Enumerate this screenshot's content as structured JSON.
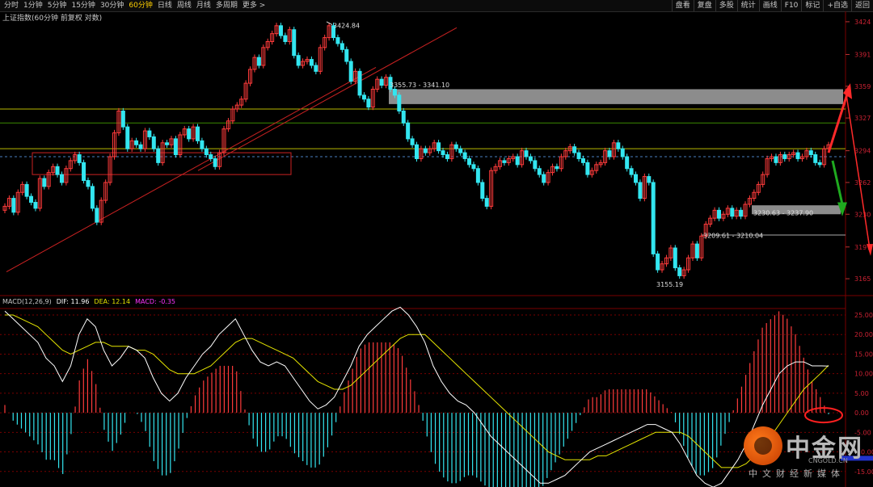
{
  "toolbar": {
    "timeframes": [
      "分时",
      "1分钟",
      "5分钟",
      "15分钟",
      "30分钟",
      "60分钟",
      "日线",
      "周线",
      "月线",
      "多周期",
      "更多 >"
    ],
    "active_index": 5,
    "right_buttons": [
      "盘看",
      "复盘",
      "多股",
      "统计",
      "画线",
      "F10",
      "标记",
      "+自选",
      "返回"
    ]
  },
  "title": "上证指数(60分钟 前复权 对数)",
  "price_axis_labels": [
    "3424",
    "3391",
    "3359",
    "3327",
    "3294",
    "3262",
    "3230",
    "3197",
    "3165"
  ],
  "macd_axis_labels": [
    "25.00",
    "20.00",
    "15.00",
    "10.00",
    "5.00",
    "0.00",
    "-5.00",
    "-10.00",
    "-15.00",
    "-20.00"
  ],
  "annotations": {
    "high": "3424.84",
    "low": "3155.19",
    "zone_upper": "3355.73 - 3341.10",
    "zone_lower": "3230.63 - 3237.90",
    "zone_bottom": "3209.61 - 3210.04"
  },
  "macd_legend": {
    "name": "MACD(12,26,9)",
    "dif": "DIF: 11.96",
    "dea": "DEA: 12.14",
    "macd": "MACD: -0.35"
  },
  "colors": {
    "up": "#ff3b3b",
    "down": "#33e6f0",
    "dif": "#ffffff",
    "dea": "#e6e600",
    "macd_label": "#ff33ff",
    "grid": "#7a0000"
  },
  "chart_data": [
    {
      "type": "candlestick",
      "ylabel": "",
      "ylim": [
        3148,
        3428
      ],
      "close": [
        3238,
        3246,
        3232,
        3252,
        3260,
        3248,
        3242,
        3236,
        3266,
        3258,
        3272,
        3278,
        3270,
        3262,
        3276,
        3284,
        3290,
        3282,
        3264,
        3258,
        3236,
        3222,
        3244,
        3262,
        3288,
        3312,
        3334,
        3318,
        3296,
        3304,
        3300,
        3296,
        3314,
        3308,
        3296,
        3282,
        3302,
        3300,
        3306,
        3290,
        3310,
        3316,
        3306,
        3318,
        3304,
        3296,
        3290,
        3286,
        3278,
        3292,
        3316,
        3324,
        3336,
        3340,
        3346,
        3362,
        3376,
        3388,
        3380,
        3398,
        3404,
        3412,
        3420,
        3410,
        3404,
        3416,
        3390,
        3380,
        3384,
        3386,
        3380,
        3374,
        3398,
        3408,
        3420,
        3408,
        3402,
        3396,
        3384,
        3364,
        3374,
        3350,
        3346,
        3338,
        3356,
        3366,
        3360,
        3368,
        3356,
        3350,
        3334,
        3322,
        3306,
        3300,
        3286,
        3296,
        3292,
        3296,
        3302,
        3294,
        3290,
        3286,
        3300,
        3296,
        3292,
        3286,
        3280,
        3276,
        3262,
        3246,
        3238,
        3274,
        3278,
        3284,
        3282,
        3286,
        3288,
        3280,
        3294,
        3288,
        3284,
        3276,
        3270,
        3262,
        3272,
        3278,
        3276,
        3288,
        3294,
        3298,
        3292,
        3286,
        3282,
        3270,
        3274,
        3280,
        3282,
        3294,
        3288,
        3302,
        3296,
        3288,
        3276,
        3270,
        3262,
        3246,
        3268,
        3262,
        3190,
        3174,
        3180,
        3186,
        3196,
        3176,
        3168,
        3174,
        3186,
        3200,
        3186,
        3208,
        3220,
        3226,
        3234,
        3226,
        3230,
        3236,
        3228,
        3234,
        3228,
        3240,
        3246,
        3252,
        3260,
        3270,
        3286,
        3288,
        3282,
        3290,
        3286,
        3290,
        3292,
        3286,
        3288,
        3294,
        3290,
        3282,
        3280,
        3296,
        3300
      ],
      "macd": {
        "dif": [
          26,
          24,
          22,
          20,
          18,
          14,
          12,
          8,
          12,
          20,
          24,
          22,
          16,
          12,
          14,
          17,
          16,
          14,
          9,
          5,
          3,
          5,
          9,
          12,
          15,
          17,
          20,
          22,
          24,
          20,
          16,
          13,
          12,
          13,
          12,
          9,
          6,
          3,
          1,
          2,
          4,
          8,
          12,
          17,
          20,
          22,
          24,
          26,
          27,
          25,
          22,
          18,
          12,
          8,
          5,
          3,
          2,
          0,
          -3,
          -6,
          -8,
          -10,
          -12,
          -14,
          -16,
          -18,
          -18,
          -17,
          -16,
          -14,
          -12,
          -10,
          -9,
          -8,
          -7,
          -6,
          -5,
          -4,
          -3,
          -3,
          -4,
          -5,
          -8,
          -12,
          -16,
          -18,
          -19,
          -18,
          -15,
          -12,
          -8,
          -3,
          2,
          6,
          10,
          12,
          13,
          13,
          12,
          12,
          11.96
        ],
        "dea": [
          25,
          25,
          24,
          23,
          22,
          20,
          18,
          16,
          15,
          16,
          17,
          18,
          18,
          17,
          17,
          17,
          16,
          16,
          15,
          13,
          11,
          10,
          10,
          10,
          11,
          12,
          14,
          16,
          18,
          19,
          19,
          18,
          17,
          16,
          15,
          14,
          12,
          10,
          8,
          7,
          6,
          6,
          7,
          9,
          11,
          13,
          15,
          17,
          19,
          20,
          20,
          20,
          18,
          16,
          14,
          12,
          10,
          8,
          6,
          4,
          2,
          0,
          -2,
          -4,
          -6,
          -8,
          -10,
          -11,
          -12,
          -12,
          -12,
          -12,
          -11,
          -11,
          -10,
          -9,
          -8,
          -7,
          -6,
          -5,
          -5,
          -5,
          -5,
          -6,
          -8,
          -10,
          -12,
          -14,
          -14,
          -14,
          -13,
          -11,
          -9,
          -6,
          -3,
          0,
          3,
          6,
          8,
          10,
          12.14
        ],
        "histogram_extent": [
          -14,
          18
        ]
      }
    }
  ]
}
